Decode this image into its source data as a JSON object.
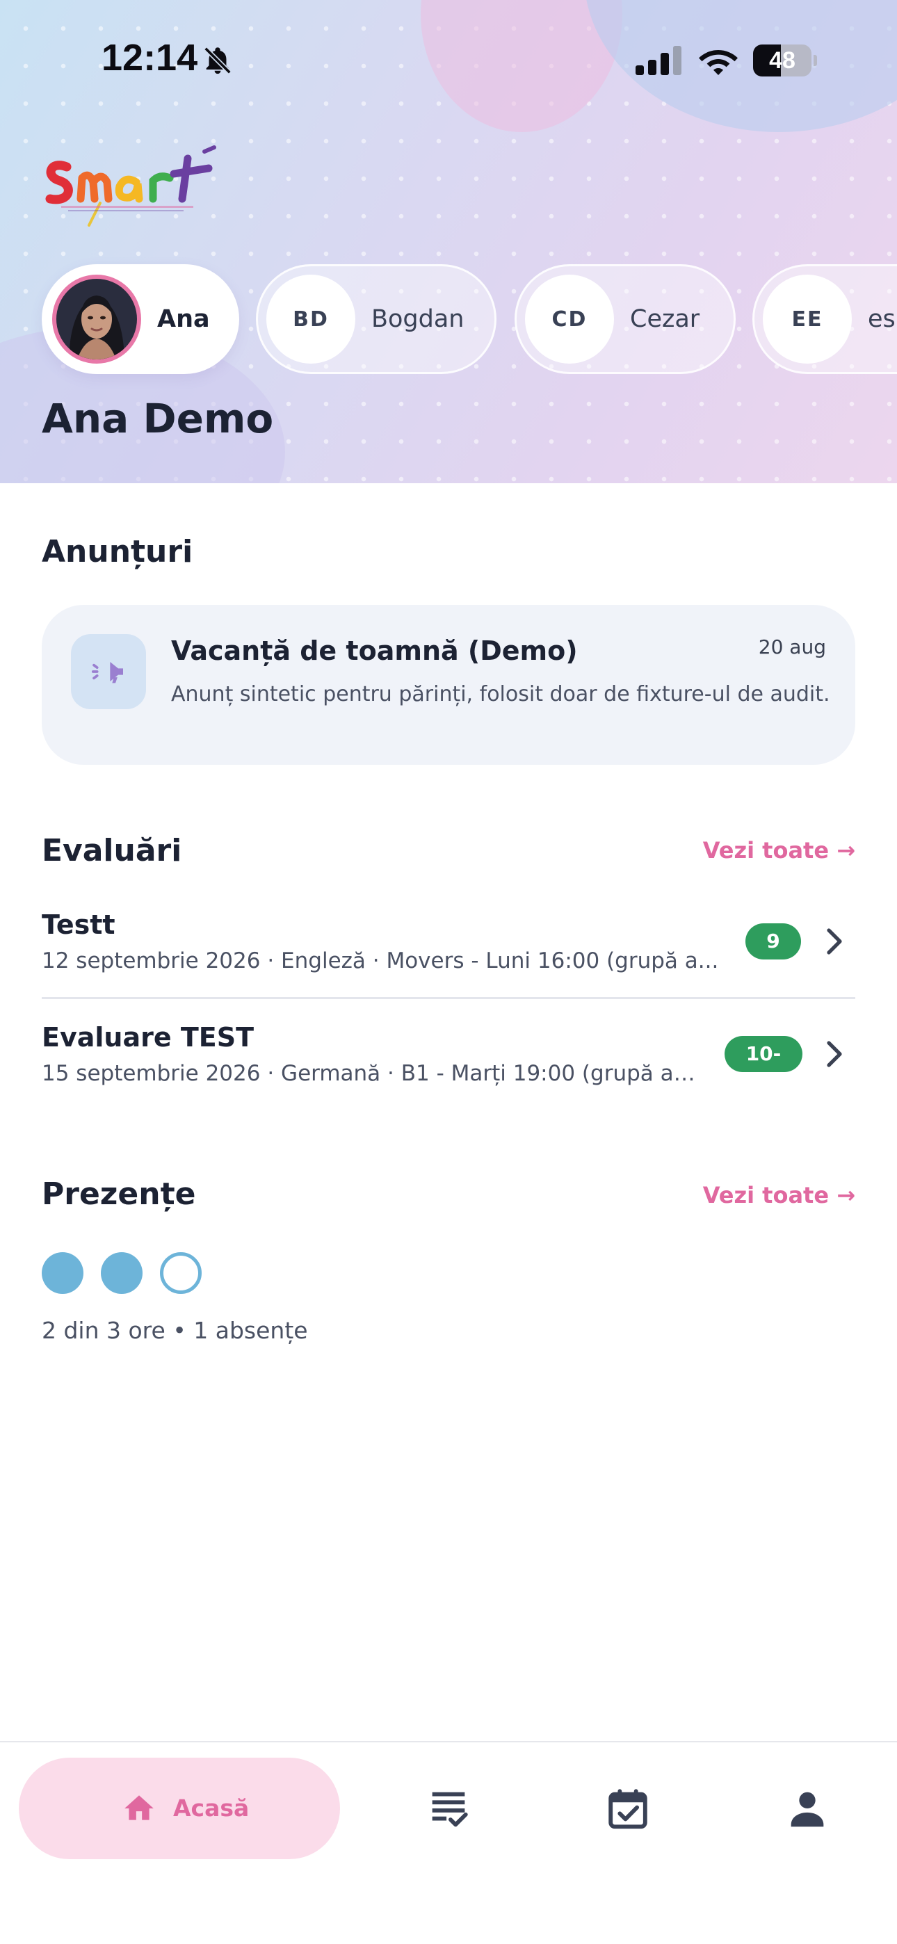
{
  "status_bar": {
    "time": "12:14",
    "battery_percent": "48",
    "battery_level": 0.48
  },
  "children": [
    {
      "initials": "",
      "name": "Ana",
      "active": true,
      "has_photo": true
    },
    {
      "initials": "BD",
      "name": "Bogdan",
      "active": false
    },
    {
      "initials": "CD",
      "name": "Cezar",
      "active": false
    },
    {
      "initials": "EE",
      "name": "es",
      "active": false
    }
  ],
  "student": {
    "full_name": "Ana Demo"
  },
  "announcements": {
    "title": "Anunțuri",
    "items": [
      {
        "title": "Vacanță de toamnă (Demo)",
        "date": "20 aug",
        "body": "Anunț sintetic pentru părinți, folosit doar de fixture-ul de audit.",
        "icon": "megaphone-icon"
      }
    ]
  },
  "evaluations": {
    "title": "Evaluări",
    "see_all": "Vezi toate →",
    "items": [
      {
        "title": "Testt",
        "subtitle": "12 septembrie 2026 · Engleză · Movers - Luni 16:00 (grupă a...",
        "grade": "9"
      },
      {
        "title": "Evaluare TEST",
        "subtitle": "15 septembrie 2026 · Germană · B1 - Marți 19:00 (grupă an...",
        "grade": "10-"
      }
    ]
  },
  "attendance": {
    "title": "Prezențe",
    "see_all": "Vezi toate →",
    "sessions": [
      "present",
      "present",
      "absent"
    ],
    "summary": "2 din 3 ore • 1 absențe"
  },
  "bottom_nav": {
    "items": [
      {
        "label": "Acasă",
        "icon": "home-icon",
        "active": true
      },
      {
        "label": "",
        "icon": "grades-list-icon",
        "active": false
      },
      {
        "label": "",
        "icon": "calendar-check-icon",
        "active": false
      },
      {
        "label": "",
        "icon": "profile-icon",
        "active": false
      }
    ]
  },
  "colors": {
    "accent_pink": "#e0689f",
    "grade_green": "#2e9d5d",
    "attendance_blue": "#6db4d9",
    "text_dark": "#1c2233"
  }
}
